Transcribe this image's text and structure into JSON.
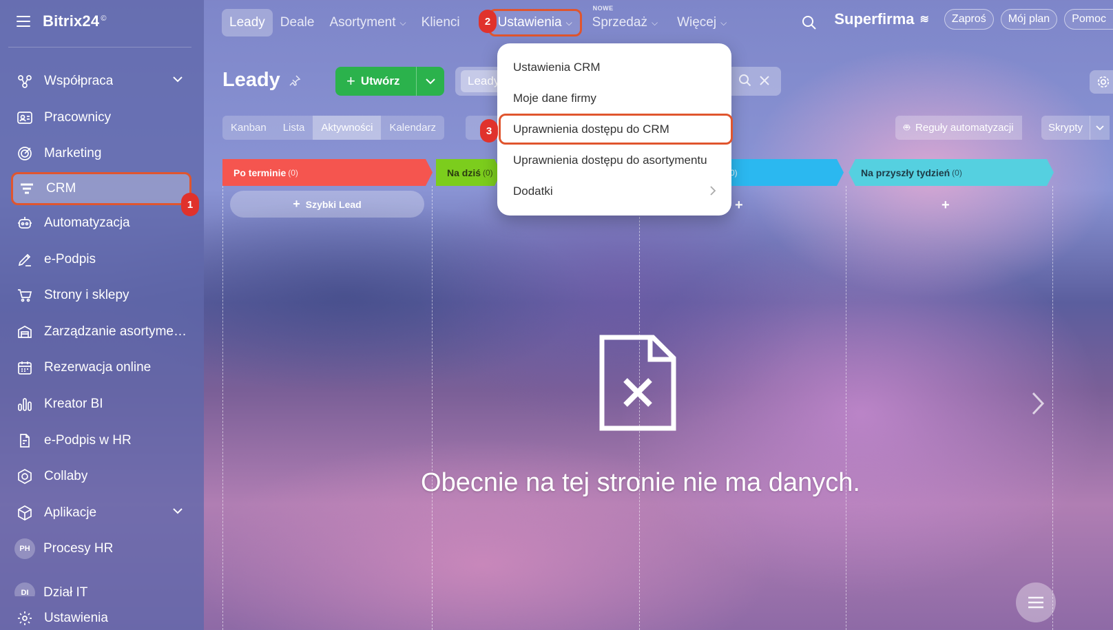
{
  "app": {
    "logo": "Bitrix24",
    "logo_mark": "©"
  },
  "sidebar": {
    "items": [
      {
        "label": "Współpraca",
        "icon": "collaboration-icon",
        "chevron": true
      },
      {
        "label": "Pracownicy",
        "icon": "employees-icon"
      },
      {
        "label": "Marketing",
        "icon": "marketing-icon"
      },
      {
        "label": "CRM",
        "icon": "crm-filter-icon",
        "active": true
      },
      {
        "label": "Automatyzacja",
        "icon": "automation-icon"
      },
      {
        "label": "e-Podpis",
        "icon": "pen-icon"
      },
      {
        "label": "Strony i sklepy",
        "icon": "cart-icon"
      },
      {
        "label": "Zarządzanie asortymen...",
        "icon": "warehouse-icon"
      },
      {
        "label": "Rezerwacja online",
        "icon": "calendar-icon"
      },
      {
        "label": "Kreator BI",
        "icon": "bar-chart-icon"
      },
      {
        "label": "e-Podpis w HR",
        "icon": "document-sign-icon"
      },
      {
        "label": "Collaby",
        "icon": "collaby-icon"
      },
      {
        "label": "Aplikacje",
        "icon": "cube-icon",
        "chevron": true
      },
      {
        "label": "Procesy HR",
        "avatar": "PH"
      },
      {
        "label": "Dział IT",
        "avatar": "DI"
      },
      {
        "label": "Ustawienia",
        "icon": "gear-icon"
      }
    ]
  },
  "topnav": {
    "items": [
      {
        "label": "Leady",
        "selected": true
      },
      {
        "label": "Deale"
      },
      {
        "label": "Asortyment",
        "dropdown": true
      },
      {
        "label": "Klienci"
      },
      {
        "label": "Ustawienia",
        "dropdown": true,
        "highlight": true
      },
      {
        "label": "Sprzedaż",
        "dropdown": true,
        "tag": "NOWE"
      },
      {
        "label": "Więcej",
        "dropdown": true
      }
    ]
  },
  "header_right": {
    "company": "Superfirma",
    "invite": "Zaproś",
    "plan": "Mój plan",
    "help": "Pomoc"
  },
  "page": {
    "title": "Leady",
    "create_button": "Utwórz",
    "filter_chip": "Leady",
    "views": [
      "Kanban",
      "Lista",
      "Aktywności",
      "Kalendarz"
    ],
    "selected_view": "Aktywności",
    "automation_rules": "Reguły automatyzacji",
    "scripts": "Skrypty"
  },
  "columns": [
    {
      "title": "Po terminie",
      "count": "(0)",
      "color": "#f5554f"
    },
    {
      "title": "Na dziś",
      "count": "(0)",
      "color": "#7ccd1d"
    },
    {
      "title": "",
      "count": "(0)",
      "color": "#2bb8f0"
    },
    {
      "title": "Na przyszły tydzień",
      "count": "(0)",
      "color": "#55d0e0"
    }
  ],
  "quick_lead": "Szybki Lead",
  "empty_state": "Obecnie na tej stronie nie ma danych.",
  "dropdown": {
    "items": [
      {
        "label": "Ustawienia CRM"
      },
      {
        "label": "Moje dane firmy"
      },
      {
        "label": "Uprawnienia dostępu do CRM",
        "highlight": true
      },
      {
        "label": "Uprawnienia dostępu do asortymentu"
      },
      {
        "label": "Dodatki",
        "submenu": true
      }
    ]
  },
  "badges": [
    "1",
    "2",
    "3"
  ],
  "colors": {
    "highlight": "#e0552e",
    "badge": "#e0322c",
    "create": "#2bb24c"
  }
}
